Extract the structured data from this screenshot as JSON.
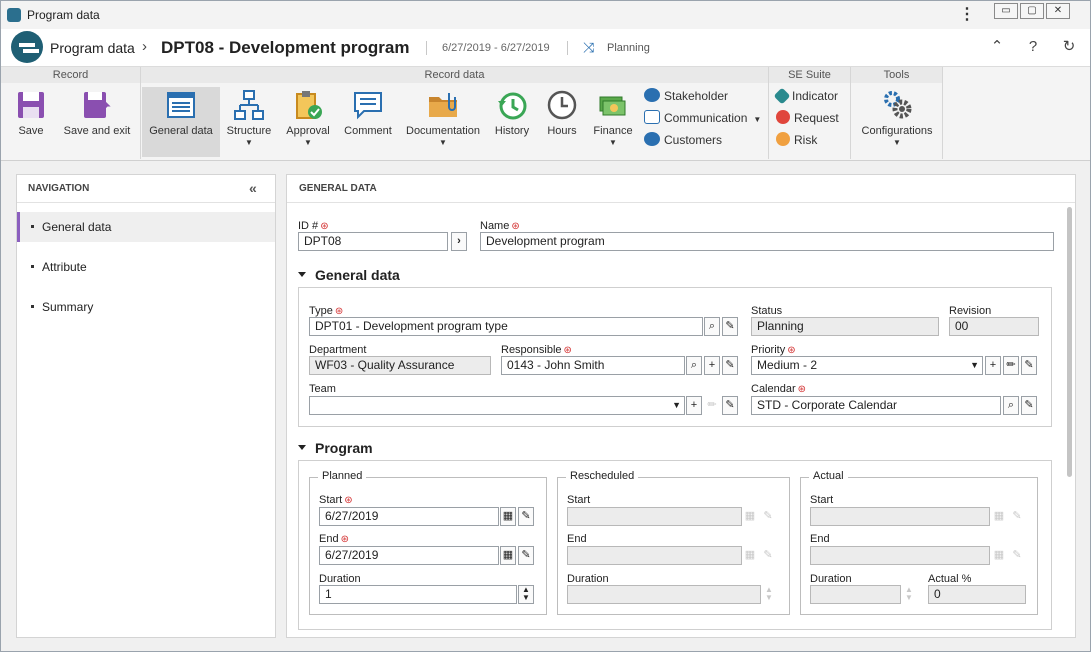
{
  "window": {
    "title": "Program data",
    "menu_icon": "kebab-icon",
    "min_label": "▭",
    "max_label": "▢",
    "close_label": "✕"
  },
  "header": {
    "app_name": "Program data",
    "separator": "›",
    "record_title": "DPT08 - Development program",
    "date_range": "6/27/2019 - 6/27/2019",
    "status": "Planning"
  },
  "ribbon": {
    "groups": [
      "Record",
      "Record data",
      "SE Suite",
      "Tools"
    ],
    "save": "Save",
    "save_exit": "Save and exit",
    "general_data": "General data",
    "structure": "Structure",
    "approval": "Approval",
    "comment": "Comment",
    "documentation": "Documentation",
    "history": "History",
    "hours": "Hours",
    "finance": "Finance",
    "stakeholder": "Stakeholder",
    "communication": "Communication",
    "customers": "Customers",
    "indicator": "Indicator",
    "request": "Request",
    "risk": "Risk",
    "configurations": "Configurations"
  },
  "nav": {
    "title": "NAVIGATION",
    "items": [
      "General data",
      "Attribute",
      "Summary"
    ]
  },
  "main": {
    "title": "GENERAL DATA",
    "id_label": "ID #",
    "id_value": "DPT08",
    "name_label": "Name",
    "name_value": "Development program",
    "section_general": "General data",
    "type_label": "Type",
    "type_value": "DPT01 - Development program type",
    "status_label": "Status",
    "status_value": "Planning",
    "revision_label": "Revision",
    "revision_value": "00",
    "department_label": "Department",
    "department_value": "WF03 - Quality Assurance",
    "responsible_label": "Responsible",
    "responsible_value": "0143 - John Smith",
    "priority_label": "Priority",
    "priority_value": "Medium - 2",
    "team_label": "Team",
    "team_value": "",
    "calendar_label": "Calendar",
    "calendar_value": "STD - Corporate Calendar",
    "section_program": "Program",
    "planned": {
      "title": "Planned",
      "start_label": "Start",
      "start_value": "6/27/2019",
      "end_label": "End",
      "end_value": "6/27/2019",
      "duration_label": "Duration",
      "duration_value": "1"
    },
    "rescheduled": {
      "title": "Rescheduled",
      "start_label": "Start",
      "end_label": "End",
      "duration_label": "Duration"
    },
    "actual": {
      "title": "Actual",
      "start_label": "Start",
      "end_label": "End",
      "duration_label": "Duration",
      "actual_pct_label": "Actual %",
      "actual_pct_value": "0"
    }
  }
}
